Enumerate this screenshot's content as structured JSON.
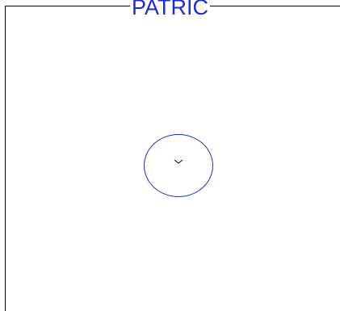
{
  "title": "PATRIC",
  "colors": {
    "accent": "#1f2bd6",
    "frame": "#000000",
    "background": "#ffffff"
  },
  "controls": {
    "expand_icon": "chevron-down-icon"
  }
}
